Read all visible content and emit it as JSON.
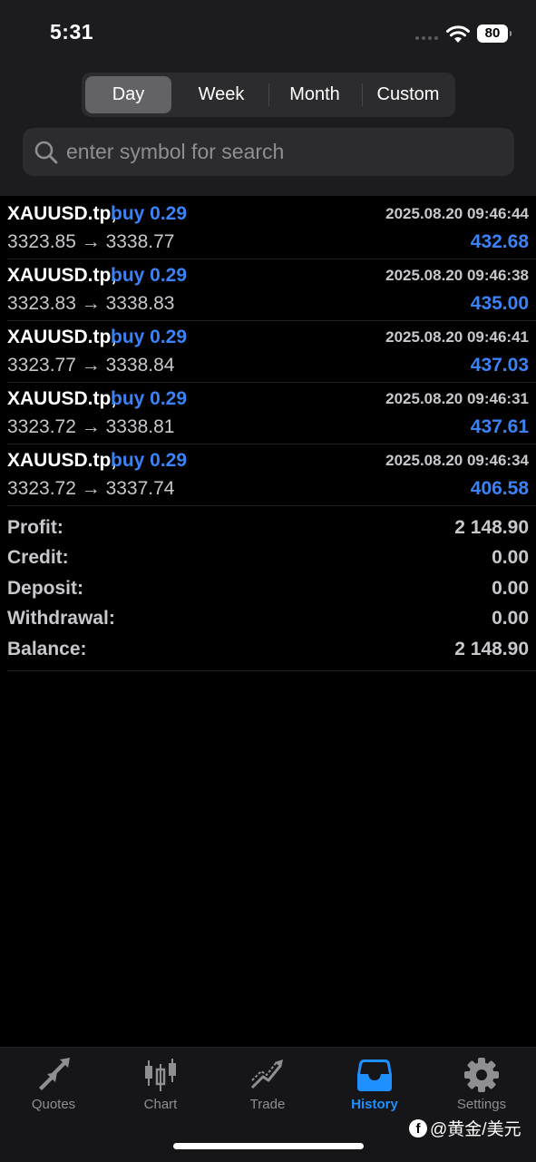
{
  "status_bar": {
    "time": "5:31",
    "battery": "80"
  },
  "period_tabs": [
    {
      "label": "Day",
      "active": true
    },
    {
      "label": "Week",
      "active": false
    },
    {
      "label": "Month",
      "active": false
    },
    {
      "label": "Custom",
      "active": false
    }
  ],
  "search": {
    "placeholder": "enter symbol for search",
    "value": ""
  },
  "deals": [
    {
      "symbol": "XAUUSD.tp,",
      "side": "buy 0.29",
      "time": "2025.08.20 09:46:44",
      "prices": "3323.85 → 3338.77",
      "profit": "432.68"
    },
    {
      "symbol": "XAUUSD.tp,",
      "side": "buy 0.29",
      "time": "2025.08.20 09:46:38",
      "prices": "3323.83 → 3338.83",
      "profit": "435.00"
    },
    {
      "symbol": "XAUUSD.tp,",
      "side": "buy 0.29",
      "time": "2025.08.20 09:46:41",
      "prices": "3323.77 → 3338.84",
      "profit": "437.03"
    },
    {
      "symbol": "XAUUSD.tp,",
      "side": "buy 0.29",
      "time": "2025.08.20 09:46:31",
      "prices": "3323.72 → 3338.81",
      "profit": "437.61"
    },
    {
      "symbol": "XAUUSD.tp,",
      "side": "buy 0.29",
      "time": "2025.08.20 09:46:34",
      "prices": "3323.72 → 3337.74",
      "profit": "406.58"
    }
  ],
  "summary": [
    {
      "label": "Profit:",
      "value": "2 148.90"
    },
    {
      "label": "Credit:",
      "value": "0.00"
    },
    {
      "label": "Deposit:",
      "value": "0.00"
    },
    {
      "label": "Withdrawal:",
      "value": "0.00"
    },
    {
      "label": "Balance:",
      "value": "2 148.90"
    }
  ],
  "tabbar": [
    {
      "label": "Quotes",
      "icon": "quotes-arrows-icon",
      "active": false
    },
    {
      "label": "Chart",
      "icon": "candlestick-chart-icon",
      "active": false
    },
    {
      "label": "Trade",
      "icon": "trade-trend-icon",
      "active": false
    },
    {
      "label": "History",
      "icon": "history-inbox-icon",
      "active": true
    },
    {
      "label": "Settings",
      "icon": "gear-icon",
      "active": false
    }
  ],
  "watermark": {
    "text": "@黄金/美元",
    "icon": "facebook-icon"
  },
  "colors": {
    "accent_blue": "#3b82f6",
    "active_tab": "#1e90ff",
    "header_bg": "#1c1c1e",
    "background": "#000000"
  }
}
